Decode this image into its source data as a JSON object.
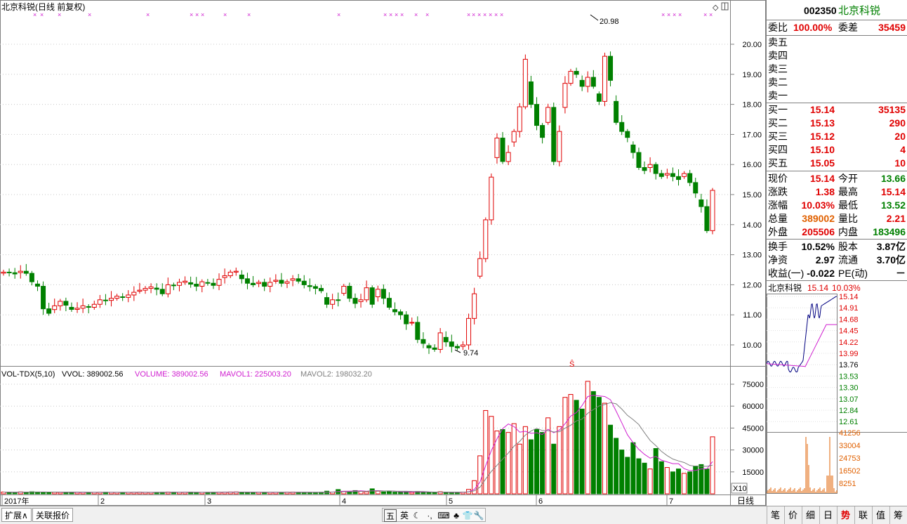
{
  "main_chart": {
    "title": "北京科锐(日线 前复权)",
    "price_axis": [
      "20.00",
      "19.00",
      "18.00",
      "17.00",
      "16.00",
      "15.00",
      "14.00",
      "13.00",
      "12.00",
      "11.00",
      "10.00"
    ],
    "high_label": "20.98",
    "low_label": "9.74",
    "marker_s": "Ŝ"
  },
  "volume_chart": {
    "name": "VOL-TDX(5,10)",
    "vvol": "VVOL: 389002.56",
    "volume": "VOLUME: 389002.56",
    "mavol1": "MAVOL1: 225003.20",
    "mavol2": "MAVOL2: 198032.20",
    "axis": [
      "75000",
      "60000",
      "45000",
      "30000",
      "15000"
    ],
    "scale_label": "X10",
    "colors": {
      "up": "#e00000",
      "down": "#008000",
      "ma1": "#d020d0",
      "ma2": "#808080"
    }
  },
  "time_axis": [
    "2017年",
    "2",
    "3",
    "4",
    "5",
    "6",
    "7"
  ],
  "period_label": "日线",
  "quote": {
    "code": "002350",
    "name": "北京科锐",
    "weibi_label": "委比",
    "weibi_value": "100.00%",
    "weicha_label": "委差",
    "weicha_value": "35459",
    "sell": [
      {
        "label": "卖五"
      },
      {
        "label": "卖四"
      },
      {
        "label": "卖三"
      },
      {
        "label": "卖二"
      },
      {
        "label": "卖一"
      }
    ],
    "buy": [
      {
        "label": "买一",
        "price": "15.14",
        "vol": "35135"
      },
      {
        "label": "买二",
        "price": "15.13",
        "vol": "290"
      },
      {
        "label": "买三",
        "price": "15.12",
        "vol": "20"
      },
      {
        "label": "买四",
        "price": "15.10",
        "vol": "4"
      },
      {
        "label": "买五",
        "price": "15.05",
        "vol": "10"
      }
    ],
    "stats": [
      {
        "l1": "现价",
        "v1": "15.14",
        "c1": "red",
        "l2": "今开",
        "v2": "13.66",
        "c2": "grn"
      },
      {
        "l1": "涨跌",
        "v1": "1.38",
        "c1": "red",
        "l2": "最高",
        "v2": "15.14",
        "c2": "red"
      },
      {
        "l1": "涨幅",
        "v1": "10.03%",
        "c1": "red",
        "l2": "最低",
        "v2": "13.52",
        "c2": "grn"
      },
      {
        "l1": "总量",
        "v1": "389002",
        "c1": "org",
        "l2": "量比",
        "v2": "2.21",
        "c2": "red"
      },
      {
        "l1": "外盘",
        "v1": "205506",
        "c1": "red",
        "l2": "内盘",
        "v2": "183496",
        "c2": "grn"
      }
    ],
    "fin": [
      {
        "l1": "换手",
        "v1": "10.52%",
        "l2": "股本",
        "v2": "3.87亿"
      },
      {
        "l1": "净资",
        "v1": "2.97",
        "l2": "流通",
        "v2": "3.70亿"
      },
      {
        "l1": "收益(一)",
        "v1": "-0.022",
        "l2": "PE(动)",
        "v2": "－"
      }
    ]
  },
  "mini_chart": {
    "name": "北京科锐",
    "price": "15.14",
    "pct": "10.03%",
    "price_axis": [
      "15.14",
      "14.91",
      "14.68",
      "14.45",
      "14.22",
      "13.99",
      "13.76",
      "13.53",
      "13.30",
      "13.07",
      "12.84",
      "12.61"
    ],
    "vol_axis": [
      "41256",
      "33004",
      "24753",
      "16502",
      "8251"
    ]
  },
  "bottom_tabs": [
    "扩展∧",
    "关联报价"
  ],
  "toolbar_items": [
    "五",
    "英",
    "☾",
    "·,",
    "⌨",
    "♣",
    "👕",
    "🔧"
  ],
  "right_tabs": [
    "笔",
    "价",
    "细",
    "日",
    "势",
    "联",
    "值",
    "筹"
  ]
}
